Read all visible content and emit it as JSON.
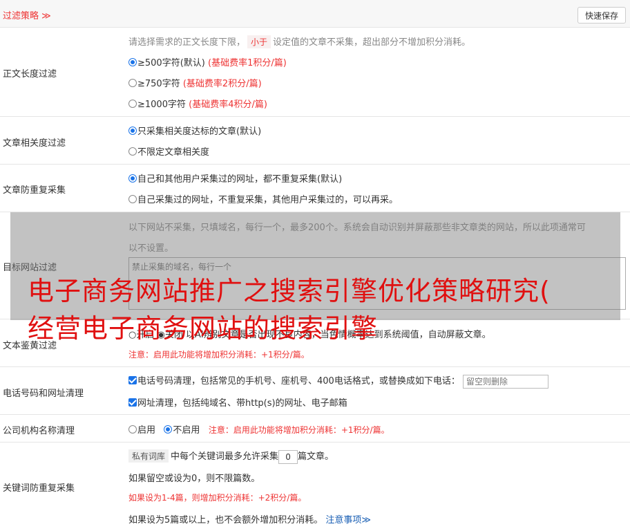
{
  "header": {
    "title": "过滤策略 ≫",
    "save_label": "快速保存"
  },
  "length": {
    "label": "正文长度过滤",
    "desc_pre": "请选择需求的正文长度下限，",
    "desc_pill": "小于",
    "desc_post": "设定值的文章不采集，超出部分不增加积分消耗。",
    "opt1": "≥500字符(默认)",
    "opt1_note": "(基础费率1积分/篇)",
    "opt2": "≥750字符",
    "opt2_note": "(基础费率2积分/篇)",
    "opt3": "≥1000字符",
    "opt3_note": "(基础费率4积分/篇)"
  },
  "relevance": {
    "label": "文章相关度过滤",
    "opt1": "只采集相关度达标的文章(默认)",
    "opt2": "不限定文章相关度"
  },
  "dup": {
    "label": "文章防重复采集",
    "opt1": "自己和其他用户采集过的网址，都不重复采集(默认)",
    "opt2": "自己采集过的网址，不重复采集，其他用户采集过的，可以再采。"
  },
  "sites": {
    "label": "目标网站过滤",
    "desc1": "以下网站不采集，只填域名，每行一个，最多200个。系统会自动识别并屏蔽那些非文章类的网站，所以此项通常可",
    "desc2": "以不设置。",
    "placeholder": "禁止采集的域名，每行一个"
  },
  "watermark": {
    "line1": "电子商务网站推广之搜索引擎优化策略研究(",
    "line2": "经营电子商务网站的搜索引擎"
  },
  "porn": {
    "label": "文本鉴黄过滤",
    "options": "○开启 ◉关闭 以AI辨别文章是否出现不良内容，当色情概率达到系统阈值，自动屏蔽文章。",
    "note": "注意：启用此功能将增加积分消耗：+1积分/篇。"
  },
  "phone": {
    "label": "电话号码和网址清理",
    "opt1": "电话号码清理，包括常见的手机号、座机号、400电话格式，或替换成如下电话：",
    "opt1_placeholder": "留空则删除",
    "opt2": "网址清理，包括纯域名、带http(s)的网址、电子邮箱"
  },
  "company": {
    "label": "公司机构名称清理",
    "opt1": "启用",
    "opt2": "不启用",
    "note": "注意：启用此功能将增加积分消耗：+1积分/篇。"
  },
  "keyword": {
    "label": "关键词防重复采集",
    "pill": "私有词库",
    "line1_pre": "中每个关键词最多允许采集",
    "num": "0",
    "line1_post": "篇文章。",
    "line2": "如果留空或设为0，则不限篇数。",
    "line3": "如果设为1-4篇，则增加积分消耗：+2积分/篇。",
    "line4": "如果设为5篇或以上，也不会额外增加积分消耗。",
    "link": "注意事项≫"
  }
}
